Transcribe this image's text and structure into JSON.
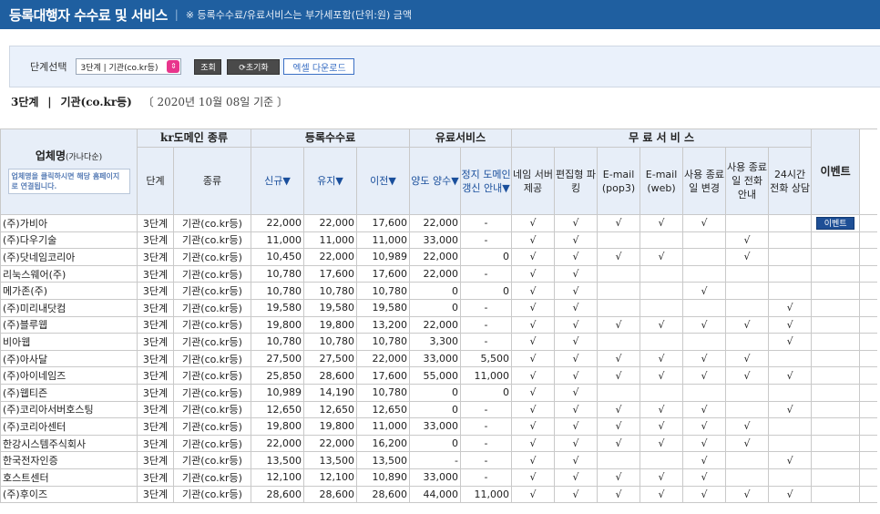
{
  "header": {
    "title": "등록대행자 수수료 및 서비스",
    "separator": "|",
    "note": "※ 등록수수료/유료서비스는 부가세포함(단위:원) 금액"
  },
  "filter": {
    "label": "단계선택",
    "select_value": "3단계 | 기관(co.kr등)",
    "search_label": "조회",
    "reset_label": "⟳초기화",
    "excel_label": "엑셀 다운로드"
  },
  "crumb": {
    "level": "3단계",
    "sep": "|",
    "category": "기관(co.kr등)",
    "date": "〔 2020년 10월 08일 기준 〕"
  },
  "table": {
    "group_headers": {
      "domain_type": "kr도메인 종류",
      "reg_fee": "등록수수료",
      "paid": "유료서비스",
      "free": "무 료 서 비 스"
    },
    "company_header": "업체명",
    "company_header_sub": "(가나다순)",
    "company_hint": "업체명을 클릭하시면 해당 홈페이지로 연결됩니다.",
    "col_level": "단계",
    "col_kind": "종류",
    "col_new": "신규▼",
    "col_renew": "유지▼",
    "col_transfer": "이전▼",
    "col_assign": "양도 양수▼",
    "col_stop_notice": "정지 도메인 갱신 안내▼",
    "col_ns": "네임 서버 제공",
    "col_edit_park": "편집형 파킹",
    "col_pop3": "E-mail (pop3)",
    "col_web": "E-mail (web)",
    "col_exp_change": "사용 종료일 변경",
    "col_exp_call": "사용 종료일 전화 안내",
    "col_24h": "24시간 전화 상담",
    "col_event": "이벤트",
    "event_button": "이벤트",
    "check": "√",
    "rows": [
      {
        "name": "(주)가비아",
        "level": "3단계",
        "kind": "기관(co.kr등)",
        "new": "22,000",
        "renew": "22,000",
        "transfer": "17,600",
        "assign": "22,000",
        "stop": "-",
        "f": [
          1,
          1,
          1,
          1,
          1,
          0,
          0
        ],
        "event": true
      },
      {
        "name": "(주)다우기술",
        "level": "3단계",
        "kind": "기관(co.kr등)",
        "new": "11,000",
        "renew": "11,000",
        "transfer": "11,000",
        "assign": "33,000",
        "stop": "-",
        "f": [
          1,
          1,
          0,
          0,
          0,
          1,
          0
        ],
        "event": false
      },
      {
        "name": "(주)닷네임코리아",
        "level": "3단계",
        "kind": "기관(co.kr등)",
        "new": "10,450",
        "renew": "22,000",
        "transfer": "10,989",
        "assign": "22,000",
        "stop": "0",
        "f": [
          1,
          1,
          1,
          1,
          0,
          1,
          0
        ],
        "event": false
      },
      {
        "name": "리눅스웨어(주)",
        "level": "3단계",
        "kind": "기관(co.kr등)",
        "new": "10,780",
        "renew": "17,600",
        "transfer": "17,600",
        "assign": "22,000",
        "stop": "-",
        "f": [
          1,
          1,
          0,
          0,
          0,
          0,
          0
        ],
        "event": false
      },
      {
        "name": "메가존(주)",
        "level": "3단계",
        "kind": "기관(co.kr등)",
        "new": "10,780",
        "renew": "10,780",
        "transfer": "10,780",
        "assign": "0",
        "stop": "0",
        "f": [
          1,
          1,
          0,
          0,
          1,
          0,
          0
        ],
        "event": false
      },
      {
        "name": "(주)미리내닷컴",
        "level": "3단계",
        "kind": "기관(co.kr등)",
        "new": "19,580",
        "renew": "19,580",
        "transfer": "19,580",
        "assign": "0",
        "stop": "-",
        "f": [
          1,
          1,
          0,
          0,
          0,
          0,
          1
        ],
        "event": false
      },
      {
        "name": "(주)블루웹",
        "level": "3단계",
        "kind": "기관(co.kr등)",
        "new": "19,800",
        "renew": "19,800",
        "transfer": "13,200",
        "assign": "22,000",
        "stop": "-",
        "f": [
          1,
          1,
          1,
          1,
          1,
          1,
          1
        ],
        "event": false
      },
      {
        "name": "비아웹",
        "level": "3단계",
        "kind": "기관(co.kr등)",
        "new": "10,780",
        "renew": "10,780",
        "transfer": "10,780",
        "assign": "3,300",
        "stop": "-",
        "f": [
          1,
          1,
          0,
          0,
          0,
          0,
          1
        ],
        "event": false
      },
      {
        "name": "(주)아사달",
        "level": "3단계",
        "kind": "기관(co.kr등)",
        "new": "27,500",
        "renew": "27,500",
        "transfer": "22,000",
        "assign": "33,000",
        "stop": "5,500",
        "f": [
          1,
          1,
          1,
          1,
          1,
          1,
          0
        ],
        "event": false
      },
      {
        "name": "(주)아이네임즈",
        "level": "3단계",
        "kind": "기관(co.kr등)",
        "new": "25,850",
        "renew": "28,600",
        "transfer": "17,600",
        "assign": "55,000",
        "stop": "11,000",
        "f": [
          1,
          1,
          1,
          1,
          1,
          1,
          1
        ],
        "event": false
      },
      {
        "name": "(주)웹티즌",
        "level": "3단계",
        "kind": "기관(co.kr등)",
        "new": "10,989",
        "renew": "14,190",
        "transfer": "10,780",
        "assign": "0",
        "stop": "0",
        "f": [
          1,
          1,
          0,
          0,
          0,
          0,
          0
        ],
        "event": false
      },
      {
        "name": "(주)코리아서버호스팅",
        "level": "3단계",
        "kind": "기관(co.kr등)",
        "new": "12,650",
        "renew": "12,650",
        "transfer": "12,650",
        "assign": "0",
        "stop": "-",
        "f": [
          1,
          1,
          1,
          1,
          1,
          0,
          1
        ],
        "event": false
      },
      {
        "name": "(주)코리아센터",
        "level": "3단계",
        "kind": "기관(co.kr등)",
        "new": "19,800",
        "renew": "19,800",
        "transfer": "11,000",
        "assign": "33,000",
        "stop": "-",
        "f": [
          1,
          1,
          1,
          1,
          1,
          1,
          0
        ],
        "event": false
      },
      {
        "name": "한강시스템주식회사",
        "level": "3단계",
        "kind": "기관(co.kr등)",
        "new": "22,000",
        "renew": "22,000",
        "transfer": "16,200",
        "assign": "0",
        "stop": "-",
        "f": [
          1,
          1,
          1,
          1,
          1,
          1,
          0
        ],
        "event": false
      },
      {
        "name": "한국전자인증",
        "level": "3단계",
        "kind": "기관(co.kr등)",
        "new": "13,500",
        "renew": "13,500",
        "transfer": "13,500",
        "assign": "-",
        "stop": "-",
        "f": [
          1,
          1,
          0,
          0,
          1,
          0,
          1
        ],
        "event": false
      },
      {
        "name": "호스트센터",
        "level": "3단계",
        "kind": "기관(co.kr등)",
        "new": "12,100",
        "renew": "12,100",
        "transfer": "10,890",
        "assign": "33,000",
        "stop": "-",
        "f": [
          1,
          1,
          1,
          1,
          1,
          0,
          0
        ],
        "event": false
      },
      {
        "name": "(주)후이즈",
        "level": "3단계",
        "kind": "기관(co.kr등)",
        "new": "28,600",
        "renew": "28,600",
        "transfer": "28,600",
        "assign": "44,000",
        "stop": "11,000",
        "f": [
          1,
          1,
          1,
          1,
          1,
          1,
          1
        ],
        "event": false
      }
    ]
  }
}
